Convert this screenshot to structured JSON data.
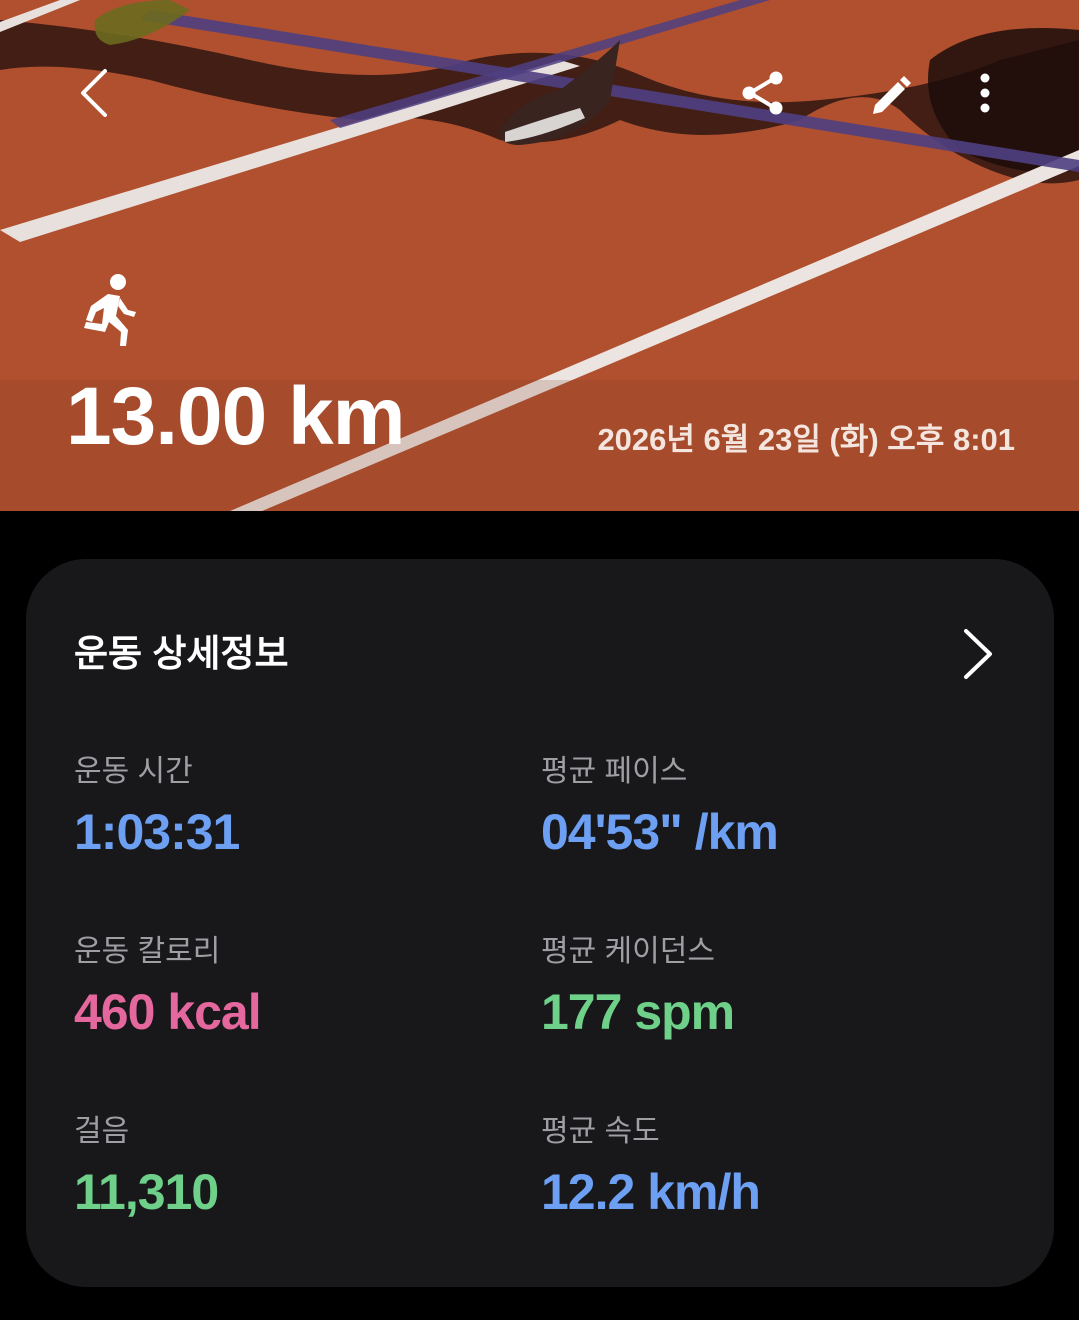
{
  "header": {
    "distance": "13.00 km",
    "datetime": "2026년 6월 23일 (화) 오후 8:01",
    "icons": {
      "back": "chevron-left-icon",
      "share": "share-icon",
      "edit": "pencil-icon",
      "more": "more-vertical-icon",
      "activity": "running-icon"
    }
  },
  "details": {
    "title": "운동 상세정보",
    "metrics": [
      {
        "label": "운동 시간",
        "value": "1:03:31",
        "color": "#6da0f2"
      },
      {
        "label": "평균 페이스",
        "value": "04'53\" /km",
        "color": "#6da0f2"
      },
      {
        "label": "운동 칼로리",
        "value": "460 kcal",
        "color": "#e4679e"
      },
      {
        "label": "평균 케이던스",
        "value": "177 spm",
        "color": "#6fd08a"
      },
      {
        "label": "걸음",
        "value": "11,310",
        "color": "#6fd08a"
      },
      {
        "label": "평균 속도",
        "value": "12.2 km/h",
        "color": "#6da0f2"
      }
    ]
  },
  "colors": {
    "background": "#000000",
    "card": "#18181b",
    "track": "#b1512f"
  }
}
